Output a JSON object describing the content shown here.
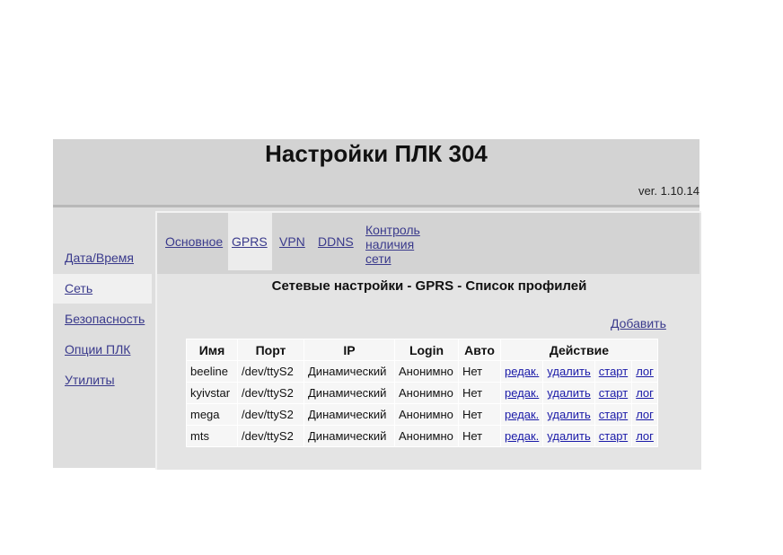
{
  "header": {
    "title": "Настройки ПЛК 304",
    "version": "ver. 1.10.14"
  },
  "sidebar": {
    "items": [
      {
        "label": "Дата/Время",
        "active": false
      },
      {
        "label": "Сеть",
        "active": true
      },
      {
        "label": "Безопасность",
        "active": false
      },
      {
        "label": "Опции ПЛК",
        "active": false
      },
      {
        "label": "Утилиты",
        "active": false
      }
    ]
  },
  "tabs": [
    {
      "label": "Основное",
      "active": false
    },
    {
      "label": "GPRS",
      "active": true
    },
    {
      "label": "VPN",
      "active": false
    },
    {
      "label": "DDNS",
      "active": false
    },
    {
      "label_lines": [
        "Контроль",
        "наличия",
        "сети"
      ],
      "active": false
    }
  ],
  "main": {
    "section_title": "Сетевые настройки - GPRS - Список профилей",
    "add_label": "Добавить"
  },
  "table": {
    "headers": {
      "name": "Имя",
      "port": "Порт",
      "ip": "IP",
      "login": "Login",
      "auto": "Авто",
      "action": "Действие"
    },
    "action_labels": {
      "edit": "редак.",
      "delete": "удалить",
      "start": "старт",
      "log": "лог"
    },
    "rows": [
      {
        "name": "beeline",
        "port": "/dev/ttyS2",
        "ip": "Динамический",
        "login": "Анонимно",
        "auto": "Нет"
      },
      {
        "name": "kyivstar",
        "port": "/dev/ttyS2",
        "ip": "Динамический",
        "login": "Анонимно",
        "auto": "Нет"
      },
      {
        "name": "mega",
        "port": "/dev/ttyS2",
        "ip": "Динамический",
        "login": "Анонимно",
        "auto": "Нет"
      },
      {
        "name": "mts",
        "port": "/dev/ttyS2",
        "ip": "Динамический",
        "login": "Анонимно",
        "auto": "Нет"
      }
    ]
  }
}
